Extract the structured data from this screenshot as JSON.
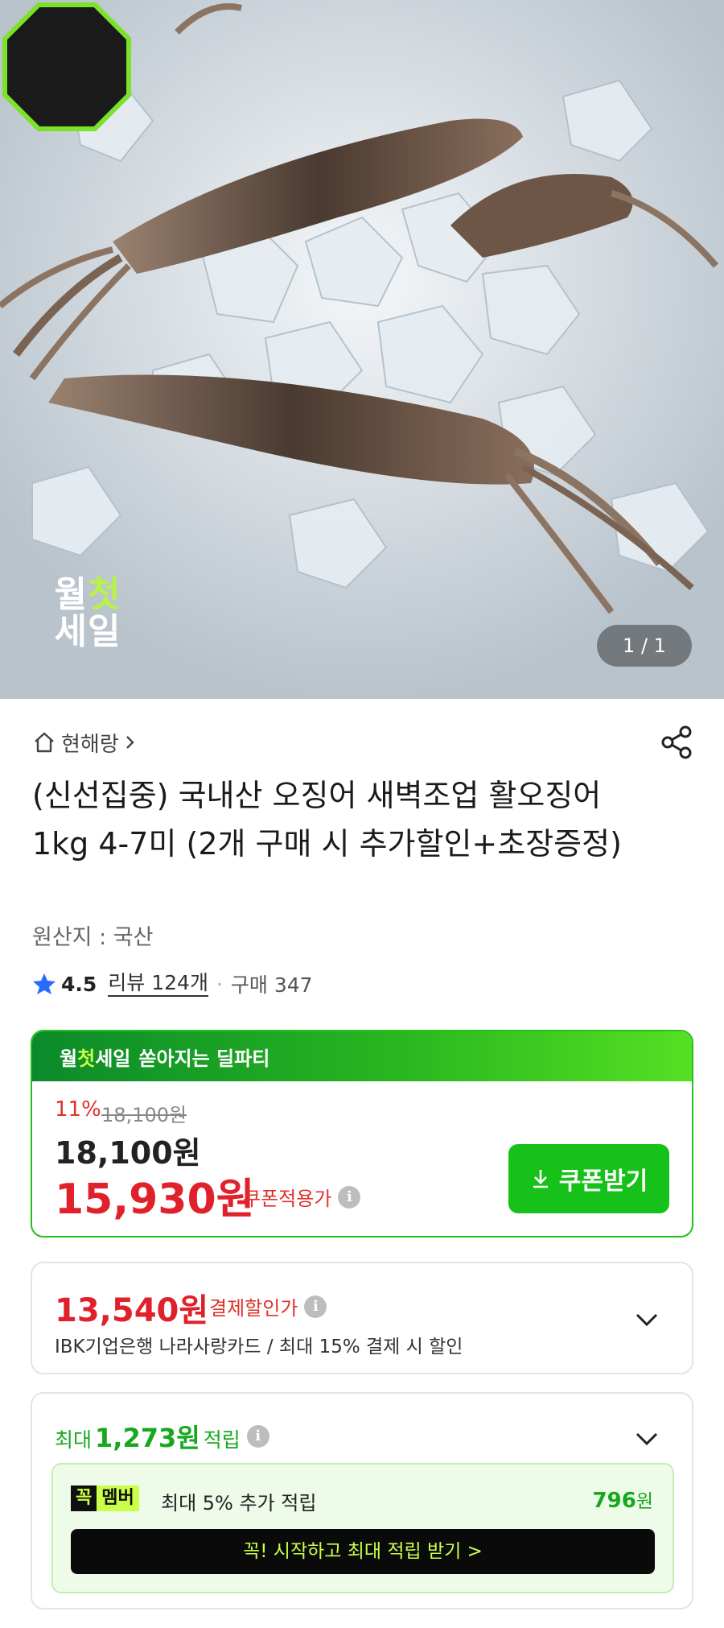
{
  "hero": {
    "badge_line1_a": "월",
    "badge_line1_b": "첫",
    "badge_line2": "세일",
    "counter": "1 / 1"
  },
  "seller": {
    "name": "현해랑",
    "icon": "home-icon"
  },
  "product": {
    "title": "(신선집중) 국내산 오징어 새벽조업 활오징어 1kg 4-7미 (2개 구매 시 추가할인+초장증정)",
    "origin": "원산지 : 국산"
  },
  "rating": {
    "score": "4.5",
    "reviews": "리뷰 124개",
    "separator": "·",
    "purchases": "구매 347"
  },
  "deal": {
    "header_a": "월",
    "header_b": "첫",
    "header_c": "세일",
    "header_d": "쏟아지는 딜파티",
    "discount_pct": "11%",
    "original_price": "18,100원",
    "price": "18,100원",
    "coupon_price": "15,930원",
    "coupon_label": "쿠폰적용가",
    "coupon_button": "쿠폰받기",
    "accent": "#16c21a"
  },
  "card_discount": {
    "amount": "13,540원",
    "label": "결제할인가",
    "description": "IBK기업은행 나라사랑카드 / 최대 15% 결제 시 할인"
  },
  "points": {
    "prefix": "최대",
    "amount": "1,273원",
    "suffix": "적립",
    "member_badge_a": "꼭",
    "member_badge_b": "멤버",
    "member_text": "최대 5% 추가 적립",
    "member_amount": "796",
    "member_amount_unit": "원",
    "member_button": "꼭! 시작하고 최대 적립 받기  >"
  }
}
